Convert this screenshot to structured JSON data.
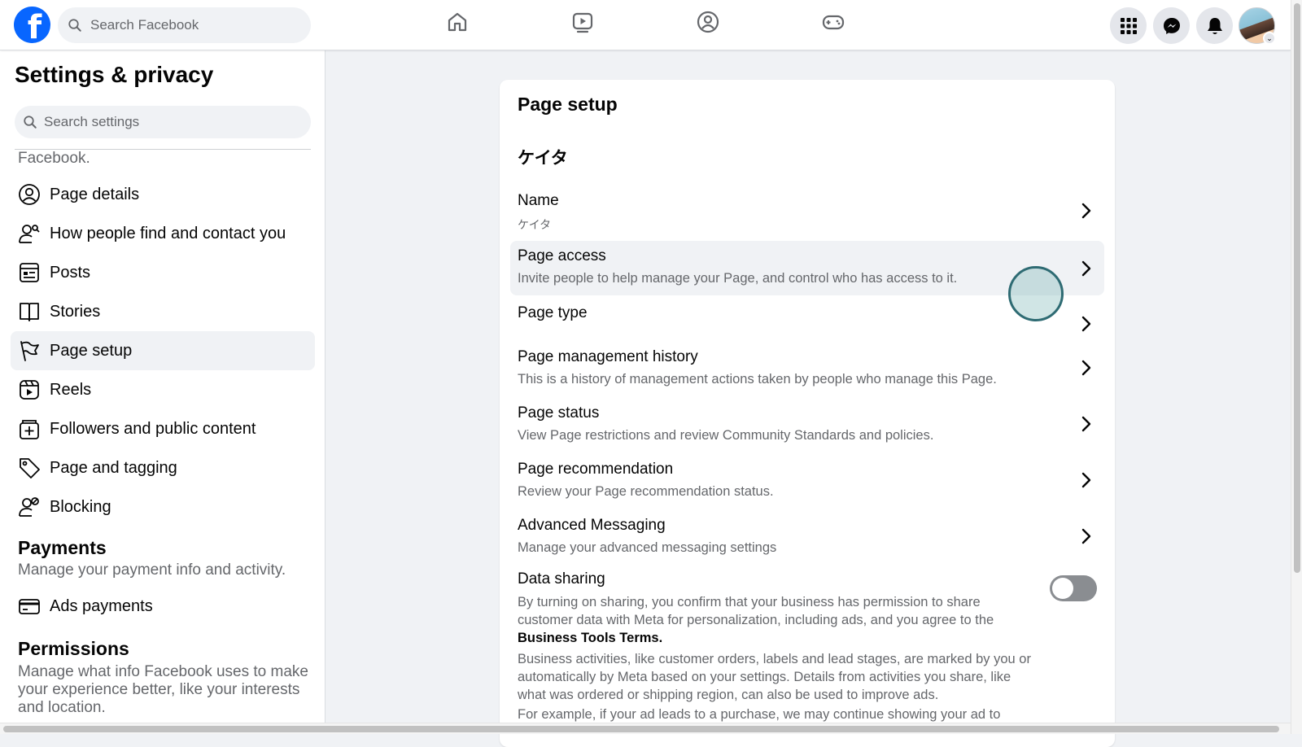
{
  "topbar": {
    "logo": "f",
    "search_placeholder": "Search Facebook",
    "nav_icons": [
      "home-icon",
      "video-icon",
      "groups-icon",
      "gaming-icon"
    ],
    "right_icons": [
      "menu-grid-icon",
      "messenger-icon",
      "notifications-icon"
    ],
    "avatar_caret": "⌄"
  },
  "sidebar": {
    "title": "Settings & privacy",
    "search_placeholder": "Search settings",
    "cut_text": "Facebook.",
    "items": [
      {
        "label": "Page details",
        "icon": "person-circle-icon"
      },
      {
        "label": "How people find and contact you",
        "icon": "person-search-icon"
      },
      {
        "label": "Posts",
        "icon": "posts-icon"
      },
      {
        "label": "Stories",
        "icon": "book-icon"
      },
      {
        "label": "Page setup",
        "icon": "flag-icon",
        "active": true
      },
      {
        "label": "Reels",
        "icon": "reels-icon"
      },
      {
        "label": "Followers and public content",
        "icon": "followers-icon"
      },
      {
        "label": "Page and tagging",
        "icon": "tag-icon"
      },
      {
        "label": "Blocking",
        "icon": "block-user-icon"
      }
    ],
    "payments": {
      "heading": "Payments",
      "sub": "Manage your payment info and activity.",
      "item": "Ads payments"
    },
    "permissions": {
      "heading": "Permissions",
      "sub": "Manage what info Facebook uses to make your experience better, like your interests and location."
    }
  },
  "main": {
    "title": "Page setup",
    "page_name": "ケイタ",
    "rows": [
      {
        "title": "Name",
        "desc": "ケイタ"
      },
      {
        "title": "Page access",
        "desc": "Invite people to help manage your Page, and control who has access to it."
      },
      {
        "title": "Page type",
        "desc": ""
      },
      {
        "title": "Page management history",
        "desc": "This is a history of management actions taken by people who manage this Page."
      },
      {
        "title": "Page status",
        "desc": "View Page restrictions and review Community Standards and policies."
      },
      {
        "title": "Page recommendation",
        "desc": "Review your Page recommendation status."
      },
      {
        "title": "Advanced Messaging",
        "desc": "Manage your advanced messaging settings"
      }
    ],
    "data_sharing": {
      "title": "Data sharing",
      "text1": "By turning on sharing, you confirm that your business has permission to share customer data with Meta for personalization, including ads, and you agree to the",
      "terms": "Business Tools Terms.",
      "text2": "Business activities, like customer orders, labels and lead stages, are marked by you or automatically by Meta based on your settings. Details from activities you share, like what was ordered or shipping region, can also be used to improve ads.",
      "text3": "For example, if your ad leads to a purchase, we may continue showing your ad to",
      "enabled": false
    }
  }
}
